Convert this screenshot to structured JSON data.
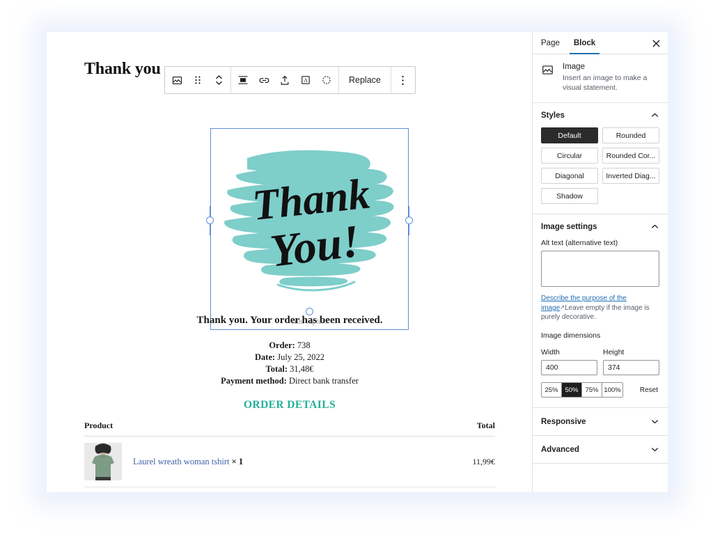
{
  "canvas": {
    "heading": "Thank you",
    "toolbar": {
      "icons": [
        {
          "name": "image-block-icon",
          "label": "Image"
        },
        {
          "name": "drag-handle-icon",
          "label": "Drag"
        },
        {
          "name": "move-up-down-icon",
          "label": "Move up or down"
        },
        {
          "name": "align-icon",
          "label": "Align"
        },
        {
          "name": "link-icon",
          "label": "Insert link"
        },
        {
          "name": "crop-upload-icon",
          "label": "Crop"
        },
        {
          "name": "add-text-over-image-icon",
          "label": "Add text over image"
        },
        {
          "name": "duotone-filter-icon",
          "label": "Apply duotone filter"
        }
      ],
      "replace_label": "Replace",
      "more_options_label": "Options"
    },
    "image": {
      "alt_art_text_line1": "Thank",
      "alt_art_text_line2": "You!",
      "caption_placeholder": "Add caption",
      "brush_color": "#7ECECA",
      "script_color": "#111111",
      "selection_color": "#5A8FD6"
    },
    "receipt": {
      "received_line": "Thank you. Your order has been received.",
      "meta": [
        {
          "label": "Order:",
          "value": "738"
        },
        {
          "label": "Date:",
          "value": "July 25, 2022"
        },
        {
          "label": "Total:",
          "value": "31,48€"
        },
        {
          "label": "Payment method:",
          "value": "Direct bank transfer"
        }
      ],
      "order_details_title": "ORDER DETAILS",
      "order_details_color": "#22B098",
      "table": {
        "columns": [
          "Product",
          "Total"
        ],
        "rows": [
          {
            "thumb": "tshirt-thumbnail",
            "name": "Laurel wreath woman tshirt",
            "qty": "× 1",
            "total": "11,99€",
            "link_color": "#3C5FA8"
          },
          {
            "thumb": "bag-thumbnail",
            "name": "",
            "qty": "",
            "total": ""
          }
        ]
      }
    }
  },
  "sidebar": {
    "tabs": [
      {
        "label": "Page",
        "active": false
      },
      {
        "label": "Block",
        "active": true
      }
    ],
    "close_label": "Close settings",
    "accent_color": "#1F6FB2",
    "block_card": {
      "icon": "image-icon",
      "title": "Image",
      "description": "Insert an image to make a visual statement."
    },
    "styles_panel": {
      "title": "Styles",
      "expanded": true,
      "options": [
        {
          "label": "Default",
          "selected": true
        },
        {
          "label": "Rounded",
          "selected": false
        },
        {
          "label": "Circular",
          "selected": false
        },
        {
          "label": "Rounded Cor...",
          "selected": false
        },
        {
          "label": "Diagonal",
          "selected": false
        },
        {
          "label": "Inverted Diag...",
          "selected": false
        },
        {
          "label": "Shadow",
          "selected": false
        }
      ]
    },
    "image_settings": {
      "title": "Image settings",
      "expanded": true,
      "alt_label": "Alt text (alternative text)",
      "alt_value": "",
      "help_link": "Describe the purpose of the image",
      "help_rest": "Leave empty if the image is purely decorative.",
      "dimensions_label": "Image dimensions",
      "width_label": "Width",
      "width_value": "400",
      "height_label": "Height",
      "height_value": "374",
      "percentages": [
        {
          "label": "25%",
          "selected": false
        },
        {
          "label": "50%",
          "selected": true
        },
        {
          "label": "75%",
          "selected": false
        },
        {
          "label": "100%",
          "selected": false
        }
      ],
      "reset_label": "Reset"
    },
    "collapsed_panels": [
      {
        "label": "Responsive"
      },
      {
        "label": "Advanced"
      }
    ]
  }
}
